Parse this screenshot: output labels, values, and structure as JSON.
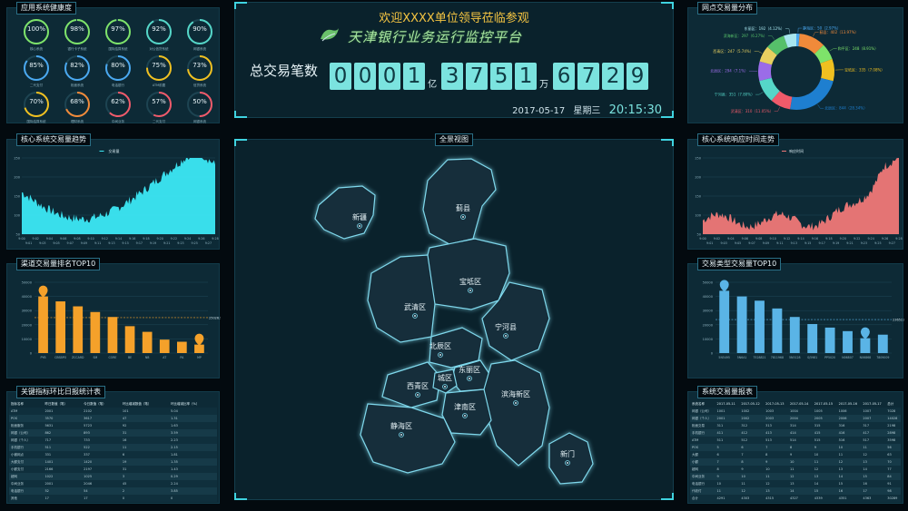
{
  "health": {
    "title": "应用系统健康度",
    "gauges": [
      {
        "value": "100%",
        "label": "核心系统",
        "pct": 1.0,
        "color": "#7ee36a"
      },
      {
        "value": "98%",
        "label": "银行卡子系统",
        "pct": 0.98,
        "color": "#7ee36a"
      },
      {
        "value": "97%",
        "label": "国际结算系统",
        "pct": 0.97,
        "color": "#7ee36a"
      },
      {
        "value": "92%",
        "label": "对公信贷系统",
        "pct": 0.92,
        "color": "#55d6c8"
      },
      {
        "value": "90%",
        "label": "网银系统",
        "pct": 0.9,
        "color": "#55d6c8"
      },
      {
        "value": "85%",
        "label": "二代支付",
        "pct": 0.85,
        "color": "#4aa8f0"
      },
      {
        "value": "82%",
        "label": "柜面系统",
        "pct": 0.82,
        "color": "#4aa8f0"
      },
      {
        "value": "80%",
        "label": "电话银行",
        "pct": 0.8,
        "color": "#4aa8f0"
      },
      {
        "value": "75%",
        "label": "ATM前置",
        "pct": 0.75,
        "color": "#f0c020"
      },
      {
        "value": "73%",
        "label": "信贷系统",
        "pct": 0.73,
        "color": "#f0c020"
      },
      {
        "value": "70%",
        "label": "国际结算系统",
        "pct": 0.7,
        "color": "#f0c020"
      },
      {
        "value": "68%",
        "label": "理财系统",
        "pct": 0.68,
        "color": "#f08a3a"
      },
      {
        "value": "62%",
        "label": "中间业务",
        "pct": 0.62,
        "color": "#f05a6a"
      },
      {
        "value": "57%",
        "label": "二代支付",
        "pct": 0.57,
        "color": "#f05a6a"
      },
      {
        "value": "50%",
        "label": "网银系统",
        "pct": 0.5,
        "color": "#f05a6a"
      }
    ]
  },
  "header": {
    "welcome": "欢迎XXXX单位领导莅临参观",
    "subtitle": "天津银行业务运行监控平台",
    "total_label": "总交易笔数",
    "digits1": [
      "0",
      "0",
      "0",
      "1"
    ],
    "unit1": "亿",
    "digits2": [
      "3",
      "7",
      "5",
      "1"
    ],
    "unit2": "万",
    "digits3": [
      "6",
      "7",
      "2",
      "9"
    ],
    "date": "2017-05-17",
    "weekday": "星期三",
    "time": "20:15:30"
  },
  "core_trend": {
    "title": "核心系统交易量趋势",
    "legend": "交易量",
    "color": "#3ce8f5"
  },
  "resp_trend": {
    "title": "核心系统响应时间走势",
    "legend": "响应时间",
    "color": "#f07878"
  },
  "trend_axis": {
    "yticks": [
      "250",
      "200",
      "150",
      "100",
      "50"
    ],
    "xticks": [
      "9:00",
      "9:02",
      "9:04",
      "9:06",
      "9:08",
      "9:10",
      "9:12",
      "9:14",
      "9:16",
      "9:18",
      "9:20",
      "9:22",
      "9:24",
      "9:26",
      "9:28"
    ],
    "xticks2": [
      "9:01",
      "9:03",
      "9:05",
      "9:07",
      "9:09",
      "9:11",
      "9:13",
      "9:15",
      "9:17",
      "9:19",
      "9:21",
      "9:23",
      "9:25",
      "9:27"
    ]
  },
  "map": {
    "title": "全景视图",
    "districts": [
      {
        "name": "新疆",
        "x": 395,
        "y": 241
      },
      {
        "name": "蓟县",
        "x": 509,
        "y": 231
      },
      {
        "name": "宝坻区",
        "x": 517,
        "y": 312
      },
      {
        "name": "武清区",
        "x": 456,
        "y": 340
      },
      {
        "name": "宁河县",
        "x": 556,
        "y": 362
      },
      {
        "name": "北辰区",
        "x": 484,
        "y": 383
      },
      {
        "name": "东丽区",
        "x": 516,
        "y": 409
      },
      {
        "name": "西青区",
        "x": 459,
        "y": 427
      },
      {
        "name": "城区",
        "x": 489,
        "y": 418
      },
      {
        "name": "滨海新区",
        "x": 567,
        "y": 436
      },
      {
        "name": "津南区",
        "x": 511,
        "y": 450
      },
      {
        "name": "静海区",
        "x": 441,
        "y": 471
      },
      {
        "name": "新门",
        "x": 624,
        "y": 502
      }
    ]
  },
  "channel_top": {
    "title": "渠道交易量排名TOP10",
    "avg_label": "25026.9",
    "color": "#f5a12a",
    "chart_data": {
      "type": "bar",
      "categories": [
        "PYB",
        "CBSBPO",
        "ZCCARD",
        "SM",
        "CORE",
        "BE",
        "NB",
        "AT",
        "PA",
        "MP"
      ],
      "values": [
        40000,
        36500,
        33000,
        29000,
        25500,
        19000,
        15000,
        9500,
        8000,
        6000
      ],
      "ylim": [
        0,
        50000
      ],
      "yticks": [
        "50000",
        "40000",
        "30000",
        "20000",
        "10000",
        "0"
      ],
      "avg": 25026.9
    }
  },
  "type_top": {
    "title": "交易类型交易量TOP10",
    "avg_label": "23652.8",
    "color": "#5ab4e6",
    "chart_data": {
      "type": "bar",
      "categories": [
        "5N5495",
        "5N6A1",
        "7528821",
        "7811968",
        "5N5128",
        "S/5981",
        "PP5020",
        "N06807",
        "N06868",
        "7809009"
      ],
      "values": [
        44000,
        40000,
        37000,
        31500,
        25500,
        20500,
        18000,
        15500,
        10500,
        13000
      ],
      "ylim": [
        0,
        50000
      ],
      "yticks": [
        "50000",
        "40000",
        "30000",
        "20000",
        "10000",
        "0"
      ],
      "avg": 23652.8
    }
  },
  "network": {
    "title": "网点交易量分布",
    "chart_data": {
      "type": "pie",
      "slices": [
        {
          "label": "静海区：50（2.97%）",
          "value": 50,
          "color": "#4aa8f0"
        },
        {
          "label": "蓟县：402（13.97%）",
          "value": 402,
          "color": "#f08a3a"
        },
        {
          "label": "和平区：248（8.91%）",
          "value": 248,
          "color": "#7ee36a"
        },
        {
          "label": "宝坻区：335（7.08%）",
          "value": 335,
          "color": "#f0c020"
        },
        {
          "label": "北辰区：844（28.34%）",
          "value": 844,
          "color": "#1e7fd0"
        },
        {
          "label": "武清区：310（11.05%）",
          "value": 310,
          "color": "#f05a6a"
        },
        {
          "label": "宁河县：351（7.80%）",
          "value": 351,
          "color": "#55d6c8"
        },
        {
          "label": "北辰区：294（7.1%）",
          "value": 294,
          "color": "#9b6ce8"
        },
        {
          "label": "西青区：247（5.74%）",
          "value": 247,
          "color": "#e8d060"
        },
        {
          "label": "滨海新区：297（6.27%）",
          "value": 297,
          "color": "#56c06a"
        },
        {
          "label": "东丽区：192（4.12%）",
          "value": 192,
          "color": "#a8e6ef"
        }
      ]
    }
  },
  "kpi": {
    "title": "关键指标环比日报统计表",
    "headers": [
      "指标名称",
      "昨日数值（笔）",
      "今日数值（笔）",
      "环比增减数值（笔）",
      "环比增减比率（%）"
    ],
    "rows": [
      [
        "ATM",
        "2001",
        "2102",
        "101",
        "5.04"
      ],
      [
        "POS",
        "3570",
        "3617",
        "47",
        "1.31"
      ],
      [
        "柜面服务",
        "5631",
        "5723",
        "92",
        "1.63"
      ],
      [
        "网银（公司）",
        "862",
        "893",
        "31",
        "3.59"
      ],
      [
        "网银（个人）",
        "717",
        "733",
        "16",
        "2.23"
      ],
      [
        "手机银行",
        "511",
        "522",
        "11",
        "2.15"
      ],
      [
        "小微网点",
        "331",
        "337",
        "6",
        "1.81"
      ],
      [
        "大额支付",
        "1401",
        "1420",
        "19",
        "1.35"
      ],
      [
        "小额支付",
        "2166",
        "2197",
        "31",
        "1.43"
      ],
      [
        "超网",
        "1022",
        "1025",
        "3",
        "0.29"
      ],
      [
        "中间业务",
        "2001",
        "2046",
        "45",
        "2.24"
      ],
      [
        "电话银行",
        "52",
        "54",
        "2",
        "3.85"
      ],
      [
        "其他",
        "17",
        "17",
        "0",
        "0"
      ]
    ]
  },
  "report": {
    "title": "系统交易量报表",
    "headers": [
      "系统名称",
      "2017-05-11",
      "2017-05-12",
      "2017-05-13",
      "2017-05-14",
      "2017-05-15",
      "2017-05-16",
      "2017-05-17",
      "总计"
    ],
    "rows": [
      [
        "网银（公司）",
        "1001",
        "1002",
        "1003",
        "1004",
        "1005",
        "1006",
        "1007",
        "7028"
      ],
      [
        "网银（个人）",
        "2001",
        "2002",
        "2003",
        "2004",
        "2005",
        "2006",
        "2007",
        "14028"
      ],
      [
        "柜面交易",
        "311",
        "312",
        "313",
        "314",
        "315",
        "316",
        "317",
        "2198"
      ],
      [
        "手机银行",
        "411",
        "412",
        "413",
        "414",
        "415",
        "416",
        "417",
        "2898"
      ],
      [
        "ATM",
        "511",
        "512",
        "513",
        "514",
        "515",
        "516",
        "517",
        "3598"
      ],
      [
        "POS",
        "5",
        "6",
        "7",
        "8",
        "9",
        "10",
        "11",
        "56"
      ],
      [
        "大额",
        "6",
        "7",
        "8",
        "9",
        "10",
        "11",
        "12",
        "63"
      ],
      [
        "小额",
        "7",
        "8",
        "9",
        "10",
        "11",
        "12",
        "13",
        "70"
      ],
      [
        "超网",
        "8",
        "9",
        "10",
        "11",
        "12",
        "13",
        "14",
        "77"
      ],
      [
        "中间业务",
        "9",
        "10",
        "11",
        "12",
        "13",
        "14",
        "15",
        "84"
      ],
      [
        "电话银行",
        "10",
        "11",
        "12",
        "13",
        "14",
        "15",
        "16",
        "91"
      ],
      [
        "代收付",
        "11",
        "12",
        "13",
        "14",
        "15",
        "16",
        "17",
        "98"
      ],
      [
        "合计",
        "4291",
        "4303",
        "4315",
        "4327",
        "4339",
        "4351",
        "4363",
        "30289"
      ]
    ]
  }
}
